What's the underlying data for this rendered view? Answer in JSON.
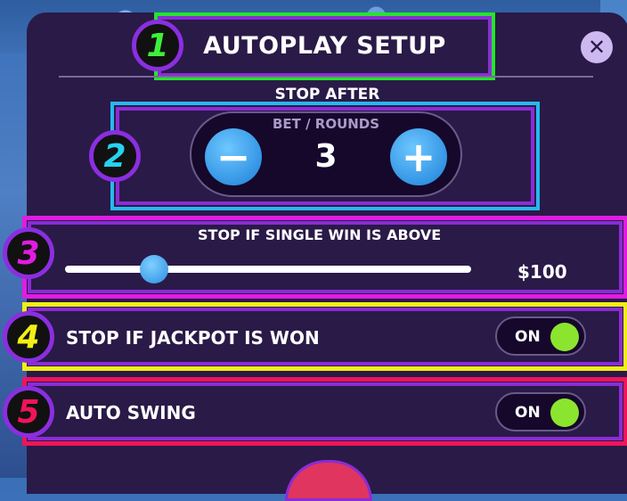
{
  "header": {
    "title": "AUTOPLAY SETUP",
    "close_icon": "close-icon"
  },
  "badges": [
    "1",
    "2",
    "3",
    "4",
    "5"
  ],
  "stop_after": {
    "label": "STOP AFTER",
    "sublabel": "BET / ROUNDS",
    "value": "3",
    "minus_icon": "minus-icon",
    "plus_icon": "plus-icon"
  },
  "single_win": {
    "label": "STOP IF SINGLE WIN IS ABOVE",
    "value": "$100",
    "slider_fraction": 0.22
  },
  "jackpot": {
    "label": "STOP IF JACKPOT IS WON",
    "toggle": "ON"
  },
  "auto_swing": {
    "label": "AUTO SWING",
    "toggle": "ON"
  },
  "colors": {
    "panel": "#2a1a47",
    "accent_blue": "#2b8de0",
    "toggle_on": "#8be52e",
    "marker_1": "#25e52a",
    "marker_2": "#27b8ef",
    "marker_3": "#e11ce1",
    "marker_4": "#f2ef16",
    "marker_5": "#f0145a"
  }
}
